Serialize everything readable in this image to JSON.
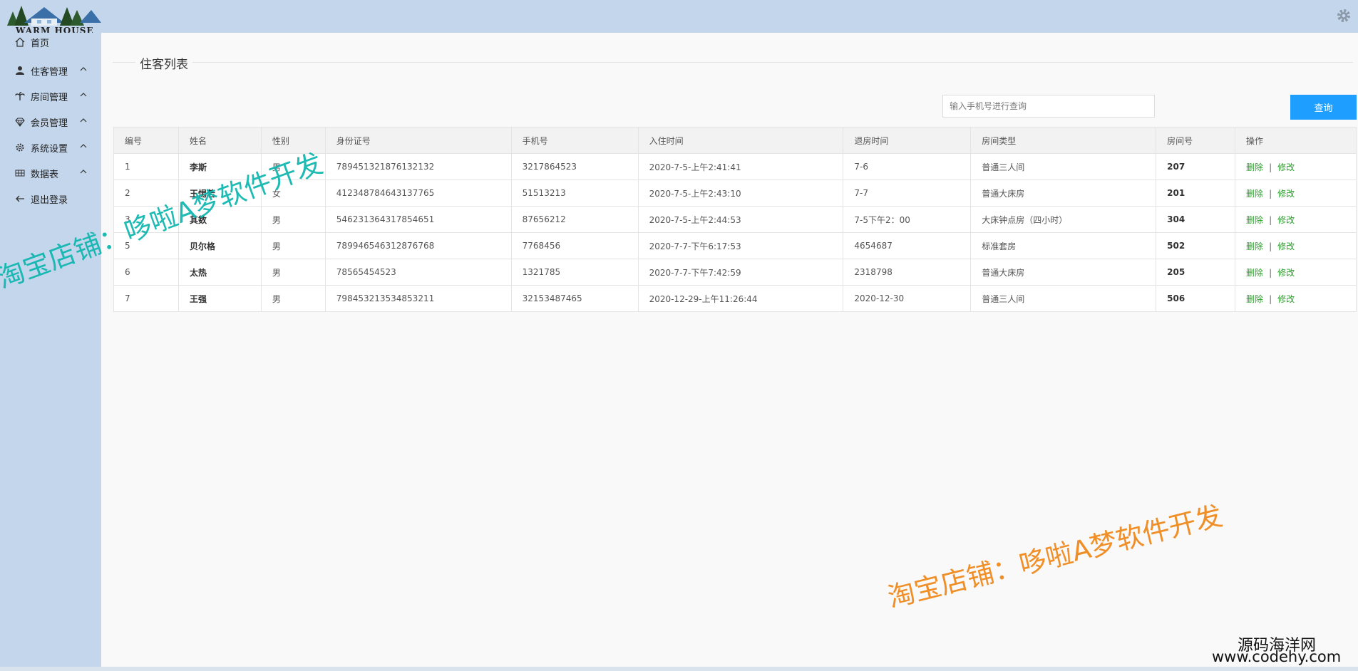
{
  "logo": {
    "text": "WARM HOUSE"
  },
  "sidebar": {
    "items": [
      {
        "label": "首页",
        "icon": "home-icon",
        "expandable": false
      },
      {
        "label": "住客管理",
        "icon": "user-icon",
        "expandable": true
      },
      {
        "label": "房间管理",
        "icon": "palm-icon",
        "expandable": true
      },
      {
        "label": "会员管理",
        "icon": "diamond-icon",
        "expandable": true
      },
      {
        "label": "系统设置",
        "icon": "gear-icon",
        "expandable": true
      },
      {
        "label": "数据表",
        "icon": "table-icon",
        "expandable": true
      },
      {
        "label": "退出登录",
        "icon": "arrow-left-icon",
        "expandable": false
      }
    ]
  },
  "main": {
    "title": "住客列表",
    "search": {
      "placeholder": "输入手机号进行查询",
      "value": "",
      "button_label": "查询"
    },
    "table": {
      "headers": [
        "编号",
        "姓名",
        "性别",
        "身份证号",
        "手机号",
        "入住时间",
        "退房时间",
        "房间类型",
        "房间号",
        "操作"
      ],
      "rows": [
        [
          "1",
          "李斯",
          "男",
          "789451321876132132",
          "3217864523",
          "2020-7-5-上午2:41:41",
          "7-6",
          "普通三人间",
          "207"
        ],
        [
          "2",
          "王惕若",
          "女",
          "412348784643137765",
          "51513213",
          "2020-7-5-上午2:43:10",
          "7-7",
          "普通大床房",
          "201"
        ],
        [
          "3",
          "其数",
          "男",
          "546231364317854651",
          "87656212",
          "2020-7-5-上午2:44:53",
          "7-5下午2：00",
          "大床钟点房（四小时）",
          "304"
        ],
        [
          "5",
          "贝尔格",
          "男",
          "789946546312876768",
          "7768456",
          "2020-7-7-下午6:17:53",
          "4654687",
          "标准套房",
          "502"
        ],
        [
          "6",
          "太热",
          "男",
          "78565454523",
          "1321785",
          "2020-7-7-下午7:42:59",
          "2318798",
          "普通大床房",
          "205"
        ],
        [
          "7",
          "王强",
          "男",
          "798453213534853211",
          "32153487465",
          "2020-12-29-上午11:26:44",
          "2020-12-30",
          "普通三人间",
          "506"
        ]
      ],
      "actions": {
        "delete": "删除",
        "separator": "|",
        "edit": "修改"
      }
    }
  },
  "watermarks": {
    "teal": "淘宝店铺：哆啦A梦软件开发",
    "orange": "淘宝店铺：哆啦A梦软件开发",
    "site_cn": "源码海洋网",
    "site_url": "www.codehy.com"
  },
  "colors": {
    "accent": "#1e9fff",
    "action": "#2a9d2a",
    "sidebar": "#c3d6ec",
    "watermark_teal": "#12b7b0",
    "watermark_orange": "#f08a1c"
  }
}
